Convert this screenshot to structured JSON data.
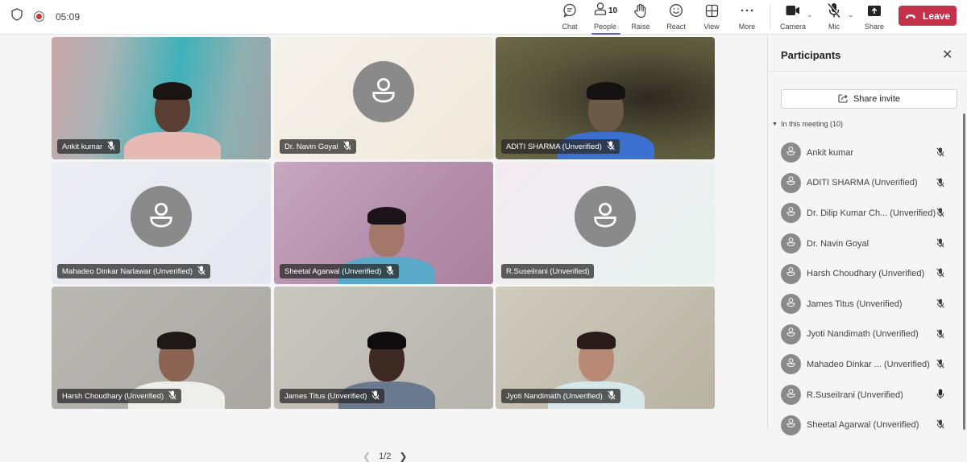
{
  "topbar": {
    "timer": "05:09",
    "buttons": [
      {
        "id": "chat",
        "label": "Chat",
        "icon": "chat-icon"
      },
      {
        "id": "people",
        "label": "People",
        "icon": "people-icon",
        "count": "10",
        "active": true
      },
      {
        "id": "raise",
        "label": "Raise",
        "icon": "hand-icon"
      },
      {
        "id": "react",
        "label": "React",
        "icon": "smiley-icon"
      },
      {
        "id": "view",
        "label": "View",
        "icon": "grid-icon"
      },
      {
        "id": "more",
        "label": "More",
        "icon": "ellipsis-icon"
      },
      {
        "id": "camera",
        "label": "Camera",
        "icon": "camera-icon"
      },
      {
        "id": "mic",
        "label": "Mic",
        "icon": "mic-off-icon"
      },
      {
        "id": "share",
        "label": "Share",
        "icon": "share-screen-icon"
      }
    ],
    "leave_label": "Leave",
    "leave_color": "#c4314b",
    "accent_color": "#5b5fc7"
  },
  "grid": {
    "tiles": [
      {
        "name": "Ankit kumar",
        "video": true,
        "muted": true
      },
      {
        "name": "Dr. Navin Goyal",
        "video": false,
        "muted": true
      },
      {
        "name": "ADITI SHARMA (Unverified)",
        "video": true,
        "muted": true
      },
      {
        "name": "Mahadeo Dinkar Narlawar (Unverified)",
        "video": false,
        "muted": true
      },
      {
        "name": "Sheetal Agarwal (Unverified)",
        "video": true,
        "muted": true
      },
      {
        "name": "R.SuseiIrani (Unverified)",
        "video": false,
        "muted": false
      },
      {
        "name": "Harsh Choudhary (Unverified)",
        "video": true,
        "muted": true
      },
      {
        "name": "James Titus (Unverified)",
        "video": true,
        "muted": true
      },
      {
        "name": "Jyoti Nandimath (Unverified)",
        "video": true,
        "muted": true
      }
    ],
    "pager": "1/2"
  },
  "panel": {
    "title": "Participants",
    "share_invite": "Share invite",
    "section_label": "In this meeting (10)",
    "participants": [
      {
        "name": "Ankit kumar",
        "muted": true
      },
      {
        "name": "ADITI SHARMA (Unverified)",
        "muted": true
      },
      {
        "name": "Dr. Dilip Kumar Ch... (Unverified)",
        "muted": true
      },
      {
        "name": "Dr. Navin Goyal",
        "muted": true
      },
      {
        "name": "Harsh Choudhary (Unverified)",
        "muted": true
      },
      {
        "name": "James Titus (Unverified)",
        "muted": true
      },
      {
        "name": "Jyoti Nandimath (Unverified)",
        "muted": true
      },
      {
        "name": "Mahadeo Dinkar ...  (Unverified)",
        "muted": true
      },
      {
        "name": "R.SuseiIrani (Unverified)",
        "muted": false
      },
      {
        "name": "Sheetal Agarwal (Unverified)",
        "muted": true
      }
    ]
  }
}
